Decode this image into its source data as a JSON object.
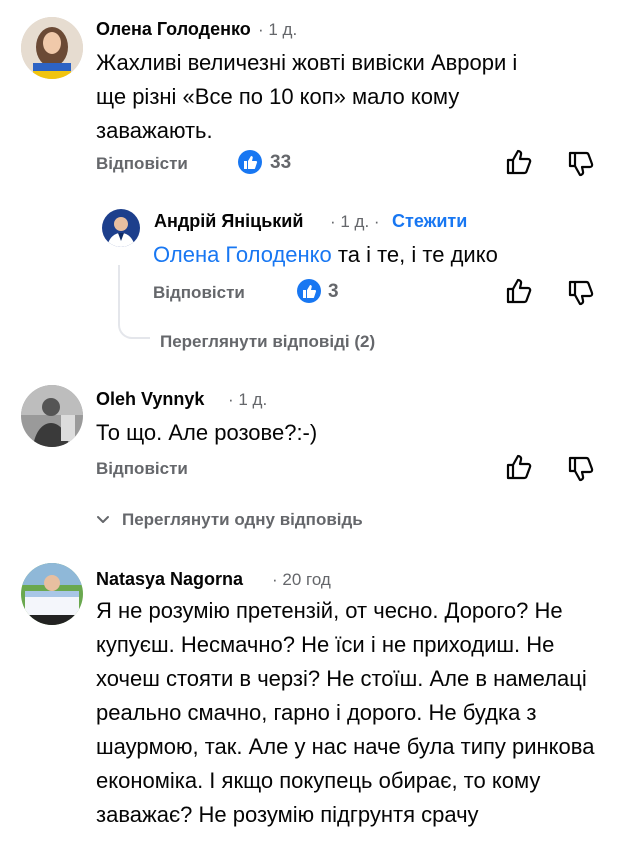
{
  "comments": [
    {
      "author": "Олена Голоденко",
      "time": "· 1 д.",
      "text": "Жахливі величезні жовті вивіски Аврори і ще різні «Все по 10 коп» мало кому заважають.",
      "reply_label": "Відповісти",
      "likes": "33"
    },
    {
      "author": "Андрій Яніцький",
      "time": "· 1 д. ·",
      "follow_label": "Стежити",
      "mention": "Олена Голоденко",
      "text": "та і те, і те дико",
      "reply_label": "Відповісти",
      "likes": "3"
    },
    {
      "view_replies": "Переглянути відповіді (2)"
    },
    {
      "author": "Oleh Vynnyk",
      "time": "· 1 д.",
      "text": "То що. Але розове?:-)",
      "reply_label": "Відповісти",
      "view_replies": "Переглянути одну відповідь"
    },
    {
      "author": "Natasya Nagorna",
      "time": "· 20 год",
      "text": "Я не розумію претензій, от чесно. Дорого? Не купуєш. Несмачно? Не їси і не приходиш. Не хочеш стояти в черзі? Не стоїш. Але в намелаці реально смачно, гарно і дорого. Не будка з шаурмою, так. Але у нас наче була типу ринкова економіка. І якщо покупець обирає, то кому заважає? Не розумію підгрунтя срачу"
    }
  ],
  "colors": {
    "accent": "#1877f2",
    "secondary_text": "#65676b",
    "text": "#050505"
  },
  "icons": [
    "like-icon",
    "thumbs-up-icon",
    "thumbs-down-icon",
    "chevron-down-icon"
  ]
}
